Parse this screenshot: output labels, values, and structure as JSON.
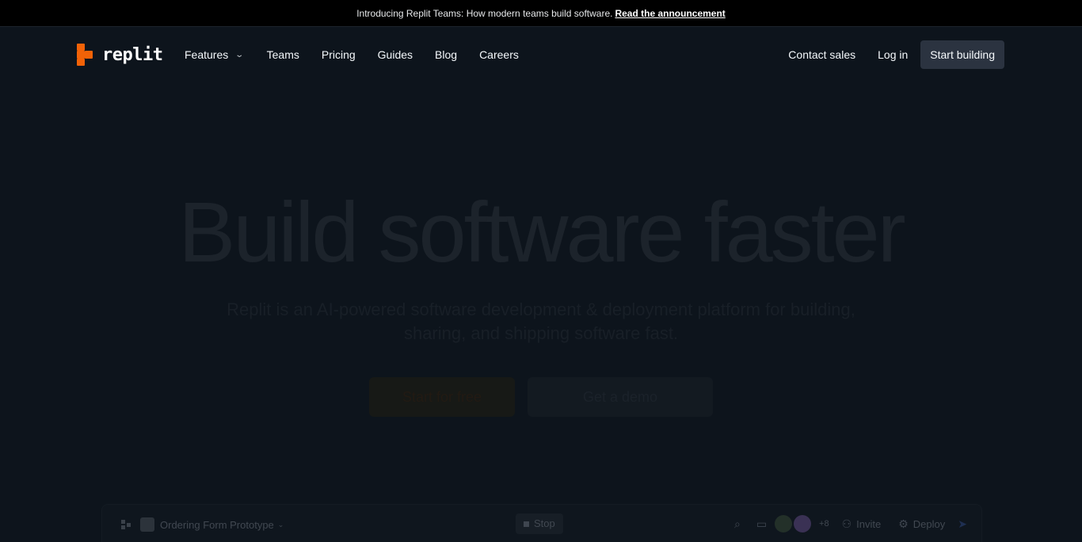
{
  "announcement": {
    "text": "Introducing Replit Teams: How modern teams build software.",
    "link": "Read the announcement"
  },
  "brand": {
    "name": "replit",
    "accent": "#f26207"
  },
  "nav": {
    "links": [
      "Features",
      "Teams",
      "Pricing",
      "Guides",
      "Blog",
      "Careers"
    ],
    "contact": "Contact sales",
    "login": "Log in",
    "cta": "Start building"
  },
  "hero": {
    "title": "Build software faster",
    "subtitle": "Replit is an AI-powered software development & deployment platform for building, sharing, and shipping software fast.",
    "primary_cta": "Start for free",
    "secondary_cta": "Get a demo"
  },
  "ide": {
    "project": "Ordering Form Prototype",
    "stop": "Stop",
    "extra_count": "+8",
    "invite": "Invite",
    "deploy": "Deploy"
  }
}
